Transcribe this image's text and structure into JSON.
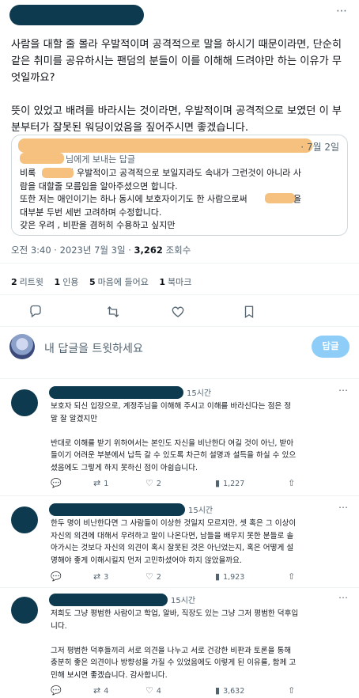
{
  "main_tweet": {
    "more_icon": "⋯",
    "paragraphs": [
      "사람을 대할 줄 몰라 우발적이며 공격적으로 말을 하시기 때문이라면, 단순히 같은 취미를 공유하시는 팬덤의 분들이 이를 이해해 드려야만 하는 이유가 무엇일까요?",
      "뜻이 있었고 배려를 바라시는 것이라면, 우발적이며 공격적으로 보였던 이 부분부터가 잘못된 워딩이었음을 짚어주시면 좋겠습니다."
    ]
  },
  "quote": {
    "date": "· 7월 2일",
    "reply_to": "님에게 보내는 답글",
    "body": "비록       가 좀 우발적이고 공격적으로 보일지라도 속내가 그런것이 아니라 사\n람을 대할줄 모름임을 알아주셨으면 합니다.\n또한 저는 애인이기는 하나 동시에 보호자이기도 한 사람으로써       의 계획을\n대부분 두번 세번 고려하며 수정합니다.\n갖은 우려 , 비판을 겸허히 수용하고 싶지만"
  },
  "meta": {
    "time_date": "오전 3:40 · 2023년 7월 3일 · ",
    "views_count": "3,262",
    "views_label": " 조회수"
  },
  "stats": {
    "retweets_count": "2",
    "retweets_label": "리트윗",
    "quotes_count": "1",
    "quotes_label": "인용",
    "likes_count": "5",
    "likes_label": "마음에 들어요",
    "bookmarks_count": "1",
    "bookmarks_label": "북마크"
  },
  "actions_icons": {
    "reply": "reply-icon",
    "retweet": "retweet-icon",
    "like": "heart-icon",
    "bookmark": "bookmark-icon"
  },
  "compose": {
    "placeholder": "내 답글을 트윗하세요",
    "button": "답글"
  },
  "replies": [
    {
      "time": "15시간",
      "text": "보호자 되신 입장으로, 계정주님을 이해해 주시고 이해를 바라신다는 점은 정\n말 잘 알겠지만\n\n반대로 이해를 받기 위하여서는 본인도 자신을 비난한다 여길 것이 아닌, 받아\n들이기 어려운 부분에서 납득 갈 수 있도록 차근히 설명과 설득을 하실 수 있으\n셨음에도 그렇게 하지 못하신 점이 아쉽습니다.",
      "reply_count": "",
      "retweet_count": "1",
      "like_count": "2",
      "view_count": "1,227"
    },
    {
      "time": "15시간",
      "text": "한두 명이 비난한다면 그 사람들이 이상한 것일지 모르지만, 셋 혹은 그 이상이\n자신의 의견에 대해서 우려하고 말이 나온다면, 남들을 배우지 못한 분들로 솔\n아가시는 것보다 자신의 의견이 혹시 잘못된 것은 아닌었는지, 혹은 어떻게 설\n명해야 좋게 이해시킬지 먼저 고민하셨어야 하지 않았을까요.",
      "reply_count": "",
      "retweet_count": "3",
      "like_count": "2",
      "view_count": "1,923"
    },
    {
      "time": "15시간",
      "text": "저희도 그냥 평범한 사람이고 학업, 알바, 직장도 있는 그냥 그저 평범한 덕후입\n니다.\n\n그저 평범한 덕후들끼리 서로 의견을 나누고 서로 건강한 비판과 토론을 통해\n충분히 좋은 의견이나 방향성을 가질 수 있었음에도 이렇게 된 이유를, 함께 고\n민해 보시면 좋겠습니다. 감사합니다.",
      "reply_count": "",
      "retweet_count": "4",
      "like_count": "4",
      "view_count": "3,632"
    }
  ]
}
